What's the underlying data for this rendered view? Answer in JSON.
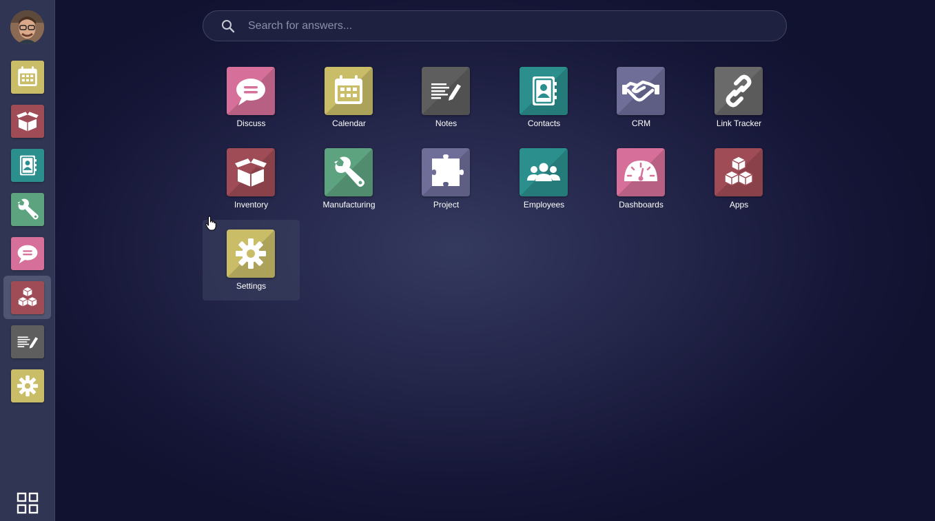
{
  "search": {
    "placeholder": "Search for answers..."
  },
  "apps": [
    {
      "label": "Discuss",
      "icon": "chat-bubble-icon",
      "color": "#d6709a"
    },
    {
      "label": "Calendar",
      "icon": "calendar-icon",
      "color": "#c9bd68"
    },
    {
      "label": "Notes",
      "icon": "note-pencil-icon",
      "color": "#5e5e5e"
    },
    {
      "label": "Contacts",
      "icon": "address-book-icon",
      "color": "#2a8f8d"
    },
    {
      "label": "CRM",
      "icon": "handshake-icon",
      "color": "#6e6e99"
    },
    {
      "label": "Link Tracker",
      "icon": "link-icon",
      "color": "#6a6a6a"
    },
    {
      "label": "Inventory",
      "icon": "open-box-icon",
      "color": "#a04c56"
    },
    {
      "label": "Manufacturing",
      "icon": "wrench-icon",
      "color": "#5ea380"
    },
    {
      "label": "Project",
      "icon": "puzzle-piece-icon",
      "color": "#6e6e99"
    },
    {
      "label": "Employees",
      "icon": "users-icon",
      "color": "#2a8f8d"
    },
    {
      "label": "Dashboards",
      "icon": "gauge-icon",
      "color": "#d6709a"
    },
    {
      "label": "Apps",
      "icon": "cubes-icon",
      "color": "#a04c56"
    },
    {
      "label": "Settings",
      "icon": "gear-icon",
      "color": "#c9bd68"
    }
  ],
  "sidebar": {
    "items": [
      {
        "name": "calendar",
        "icon": "calendar-icon",
        "color": "#c9bd68"
      },
      {
        "name": "inventory",
        "icon": "open-box-icon",
        "color": "#a04c56"
      },
      {
        "name": "contacts",
        "icon": "address-book-icon",
        "color": "#2a8f8d"
      },
      {
        "name": "manufacturing",
        "icon": "wrench-icon",
        "color": "#5ea380"
      },
      {
        "name": "discuss",
        "icon": "chat-bubble-icon",
        "color": "#d6709a"
      },
      {
        "name": "apps",
        "icon": "cubes-icon",
        "color": "#a04c56",
        "active": true
      },
      {
        "name": "notes",
        "icon": "note-pencil-icon",
        "color": "#5e5e5e"
      },
      {
        "name": "settings",
        "icon": "gear-icon",
        "color": "#c9bd68"
      }
    ],
    "bottom_icon": "grid-icon"
  },
  "colors": {
    "sidebar_bg": "#2f3553",
    "active_item_bg": "#505672",
    "search_bg": "#1e2140"
  }
}
